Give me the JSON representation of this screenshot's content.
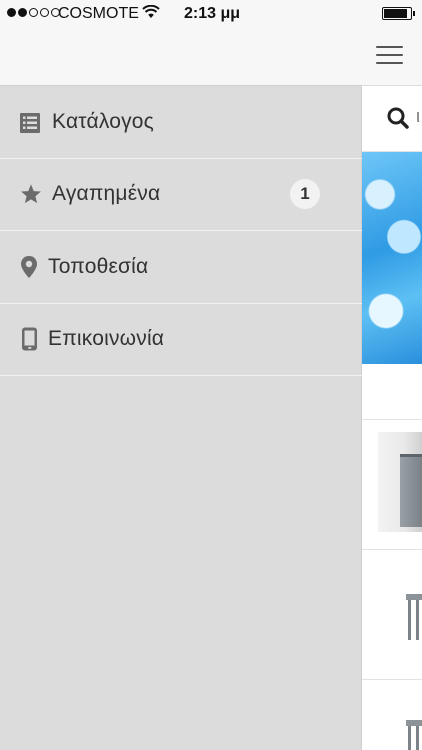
{
  "status_bar": {
    "carrier": "COSMOTE",
    "time": "2:13 μμ"
  },
  "search": {
    "peek_text": "ι"
  },
  "drawer": {
    "items": [
      {
        "label": "Κατάλογος",
        "icon": "list-icon"
      },
      {
        "label": "Αγαπημένα",
        "icon": "star-icon",
        "badge": "1"
      },
      {
        "label": "Τοποθεσία",
        "icon": "location-pin-icon"
      },
      {
        "label": "Επικοινωνία",
        "icon": "phone-icon"
      }
    ]
  },
  "colors": {
    "drawer_bg": "#dcdcdc",
    "header_bg": "#f7f7f7",
    "icon": "#6b6b6b",
    "text": "#333333"
  }
}
